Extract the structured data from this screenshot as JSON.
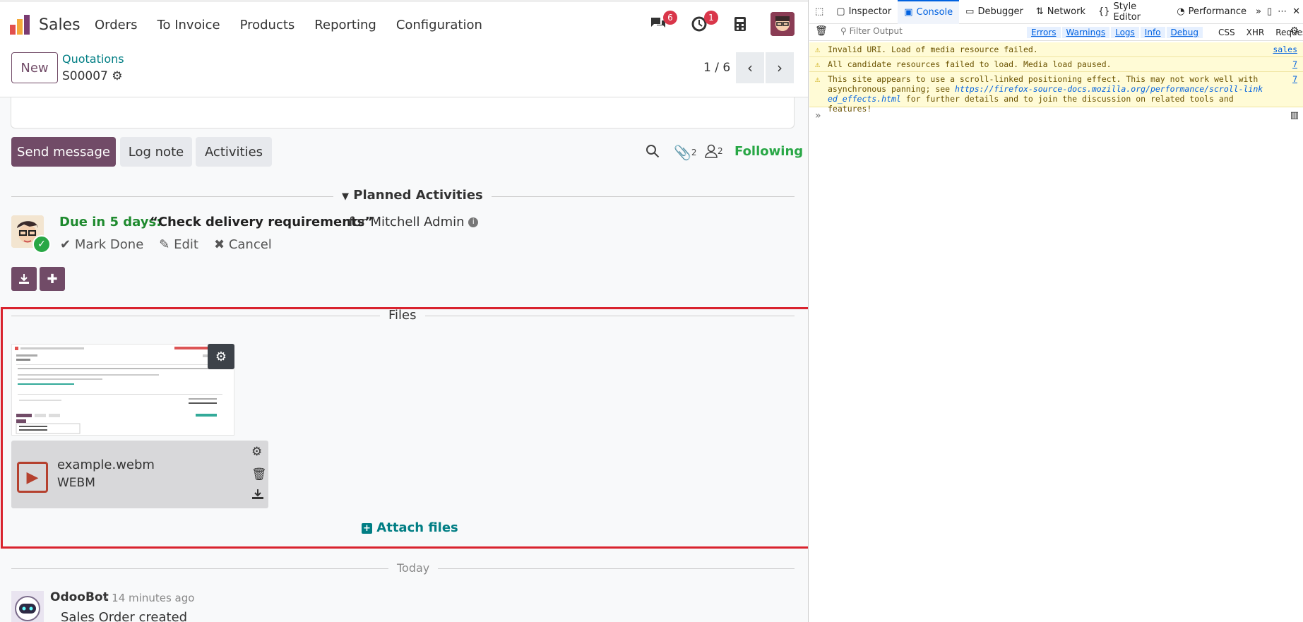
{
  "navbar": {
    "app_name": "Sales",
    "menu": [
      "Orders",
      "To Invoice",
      "Products",
      "Reporting",
      "Configuration"
    ],
    "messages_count": "6",
    "activities_count": "1"
  },
  "control_panel": {
    "new_label": "New",
    "breadcrumb": "Quotations",
    "record": "S00007",
    "pager": "1 / 6"
  },
  "chatter": {
    "send_message": "Send message",
    "log_note": "Log note",
    "activities": "Activities",
    "attachments_count": "2",
    "followers_count": "2",
    "following": "Following"
  },
  "planned": {
    "title": "Planned Activities",
    "due": "Due in 5 days:",
    "summary": "“Check delivery requirements”",
    "for_user": "for Mitchell Admin",
    "mark_done": "Mark Done",
    "edit": "Edit",
    "cancel": "Cancel"
  },
  "files": {
    "title": "Files",
    "file_name": "example.webm",
    "file_ext": "WEBM",
    "attach": "Attach files"
  },
  "thread": {
    "today": "Today",
    "author": "OdooBot",
    "time": "- 14 minutes ago",
    "message": "Sales Order created"
  },
  "devtools": {
    "tabs": [
      "Inspector",
      "Console",
      "Debugger",
      "Network",
      "Style Editor",
      "Performance"
    ],
    "filter_placeholder": "Filter Output",
    "filters_active": [
      "Errors",
      "Warnings",
      "Logs",
      "Info",
      "Debug"
    ],
    "filters_other": [
      "CSS",
      "XHR",
      "Requests"
    ],
    "messages": [
      {
        "text": "Invalid URI. Load of media resource  failed.",
        "src": "sales"
      },
      {
        "text": "All candidate resources failed to load. Media load paused.",
        "src": "7"
      },
      {
        "text_pre": "This site appears to use a scroll-linked positioning effect. This may not work well with asynchronous panning; see ",
        "link": "https://firefox-source-docs.mozilla.org/performance/scroll-linked_effects.html",
        "text_post": " for further details and to join the discussion on related tools and features!",
        "src": "7"
      }
    ],
    "prompt": "»"
  },
  "colors": {
    "brand": "#714b67",
    "link": "#017e84",
    "success": "#28a745",
    "highlight": "#d9232e"
  }
}
